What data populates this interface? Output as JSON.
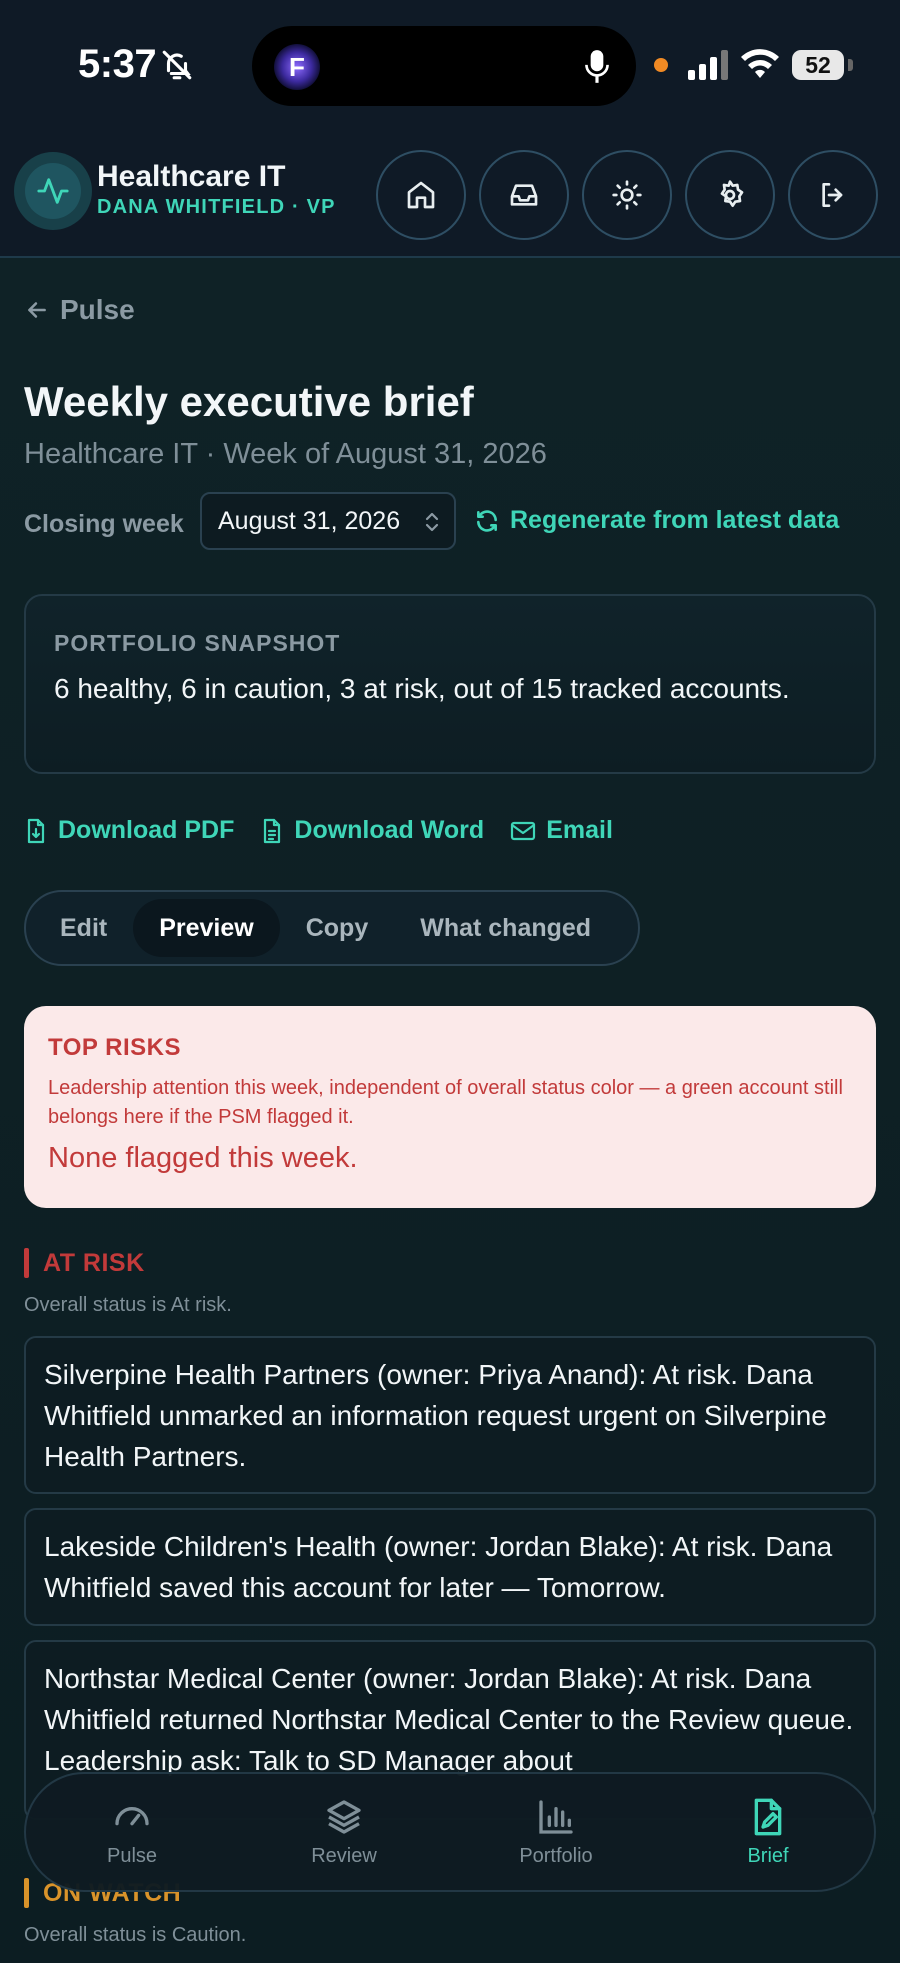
{
  "status_bar": {
    "time": "5:37",
    "battery": "52",
    "island_app_letter": "F"
  },
  "header": {
    "org_name": "Healthcare IT",
    "user_line": "DANA WHITFIELD · VP",
    "buttons": [
      "home-icon",
      "inbox-icon",
      "sun-icon",
      "gear-icon",
      "logout-icon"
    ]
  },
  "page": {
    "back_label": "Pulse",
    "title": "Weekly executive brief",
    "subtitle": "Healthcare IT · Week of August 31, 2026",
    "closing_label": "Closing week",
    "closing_value": "August 31, 2026",
    "regenerate_label": "Regenerate from latest data"
  },
  "snapshot": {
    "label": "PORTFOLIO SNAPSHOT",
    "text": "6 healthy, 6 in caution, 3 at risk, out of 15 tracked accounts."
  },
  "actions": {
    "download_pdf": "Download PDF",
    "download_word": "Download Word",
    "email": "Email"
  },
  "tabs": [
    {
      "label": "Edit",
      "active": false
    },
    {
      "label": "Preview",
      "active": true
    },
    {
      "label": "Copy",
      "active": false
    },
    {
      "label": "What changed",
      "active": false
    }
  ],
  "top_risks": {
    "heading": "TOP RISKS",
    "description": "Leadership attention this week, independent of overall status color — a green account still belongs here if the PSM flagged it.",
    "none_text": "None flagged this week."
  },
  "at_risk": {
    "heading": "AT RISK",
    "sub": "Overall status is At risk.",
    "items": [
      "Silverpine Health Partners (owner: Priya Anand): At risk. Dana Whitfield unmarked an information request urgent on Silverpine Health Partners.",
      "Lakeside Children's Health (owner: Jordan Blake): At risk. Dana Whitfield saved this account for later — Tomorrow.",
      "Northstar Medical Center (owner: Jordan Blake): At risk. Dana Whitfield returned Northstar Medical Center to the Review queue. Leadership ask: Talk to SD Manager about"
    ]
  },
  "on_watch": {
    "heading": "ON WATCH",
    "sub": "Overall status is Caution."
  },
  "bottom_nav": [
    {
      "label": "Pulse",
      "icon": "gauge-icon",
      "active": false
    },
    {
      "label": "Review",
      "icon": "layers-icon",
      "active": false
    },
    {
      "label": "Portfolio",
      "icon": "bar-chart-icon",
      "active": false
    },
    {
      "label": "Brief",
      "icon": "document-pen-icon",
      "active": true
    }
  ],
  "colors": {
    "accent": "#3fd6b8",
    "risk_red": "#c23a3a",
    "watch_amber": "#d9932a",
    "background": "#0e1d23"
  }
}
